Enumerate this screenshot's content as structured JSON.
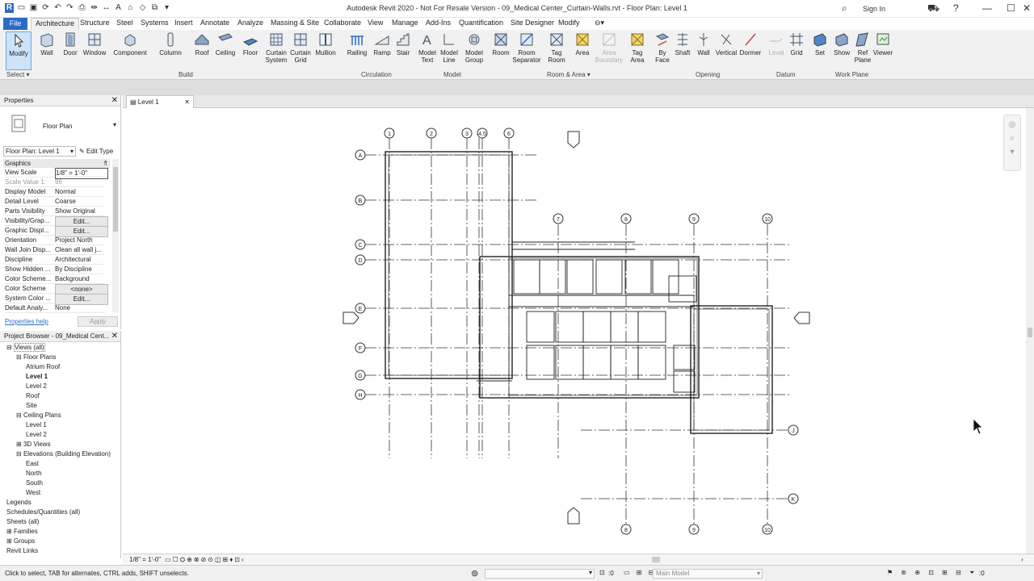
{
  "app": {
    "title": "Autodesk Revit 2020 - Not For Resale Version - 09_Medical Center_Curtain-Walls.rvt - Floor Plan: Level 1",
    "sign_in": "Sign In"
  },
  "tabs": [
    "File",
    "Architecture",
    "Structure",
    "Steel",
    "Systems",
    "Insert",
    "Annotate",
    "Analyze",
    "Massing & Site",
    "Collaborate",
    "View",
    "Manage",
    "Add-Ins",
    "Quantification",
    "Site Designer",
    "Modify"
  ],
  "ribbon": {
    "buttons": [
      {
        "label": "Modify",
        "icon": "modify-cursor-icon"
      },
      {
        "label": "Wall",
        "icon": "wall-icon"
      },
      {
        "label": "Door",
        "icon": "door-icon"
      },
      {
        "label": "Window",
        "icon": "window-icon"
      },
      {
        "label": "Component",
        "icon": "component-icon"
      },
      {
        "label": "Column",
        "icon": "column-icon"
      },
      {
        "label": "Roof",
        "icon": "roof-icon"
      },
      {
        "label": "Ceiling",
        "icon": "ceiling-icon"
      },
      {
        "label": "Floor",
        "icon": "floor-icon"
      },
      {
        "label": "Curtain System",
        "icon": "curtain-system-icon"
      },
      {
        "label": "Curtain Grid",
        "icon": "curtain-grid-icon"
      },
      {
        "label": "Mullion",
        "icon": "mullion-icon"
      },
      {
        "label": "Railing",
        "icon": "railing-icon"
      },
      {
        "label": "Ramp",
        "icon": "ramp-icon"
      },
      {
        "label": "Stair",
        "icon": "stair-icon"
      },
      {
        "label": "Model Text",
        "icon": "model-text-icon"
      },
      {
        "label": "Model Line",
        "icon": "model-line-icon"
      },
      {
        "label": "Model Group",
        "icon": "model-group-icon"
      },
      {
        "label": "Room",
        "icon": "room-icon"
      },
      {
        "label": "Room Separator",
        "icon": "room-separator-icon"
      },
      {
        "label": "Tag Room",
        "icon": "tag-room-icon"
      },
      {
        "label": "Area",
        "icon": "area-icon"
      },
      {
        "label": "Area Boundary",
        "icon": "area-boundary-icon"
      },
      {
        "label": "Tag Area",
        "icon": "tag-area-icon"
      },
      {
        "label": "By Face",
        "icon": "by-face-icon"
      },
      {
        "label": "Shaft",
        "icon": "shaft-icon"
      },
      {
        "label": "Wall",
        "icon": "wall-opening-icon"
      },
      {
        "label": "Vertical",
        "icon": "vertical-opening-icon"
      },
      {
        "label": "Dormer",
        "icon": "dormer-icon"
      },
      {
        "label": "Level",
        "icon": "level-icon"
      },
      {
        "label": "Grid",
        "icon": "grid-icon"
      },
      {
        "label": "Set",
        "icon": "set-icon"
      },
      {
        "label": "Show",
        "icon": "show-icon"
      },
      {
        "label": "Ref Plane",
        "icon": "ref-plane-icon"
      },
      {
        "label": "Viewer",
        "icon": "viewer-icon"
      }
    ],
    "groups": [
      "Select",
      "Build",
      "Circulation",
      "Model",
      "Room & Area",
      "Opening",
      "Datum",
      "Work Plane"
    ]
  },
  "properties": {
    "title": "Properties",
    "type_name": "Floor Plan",
    "instance_selector": "Floor Plan: Level 1",
    "edit_type": "Edit Type",
    "section": "Graphics",
    "rows": [
      {
        "k": "View Scale",
        "v": "1/8\" = 1'-0\""
      },
      {
        "k": "Scale Value  1:",
        "v": "96"
      },
      {
        "k": "Display Model",
        "v": "Normal"
      },
      {
        "k": "Detail Level",
        "v": "Coarse"
      },
      {
        "k": "Parts Visibility",
        "v": "Show Original"
      },
      {
        "k": "Visibility/Grap...",
        "v": "Edit..."
      },
      {
        "k": "Graphic Displ...",
        "v": "Edit..."
      },
      {
        "k": "Orientation",
        "v": "Project North"
      },
      {
        "k": "Wall Join Disp...",
        "v": "Clean all wall j..."
      },
      {
        "k": "Discipline",
        "v": "Architectural"
      },
      {
        "k": "Show Hidden ...",
        "v": "By Discipline"
      },
      {
        "k": "Color Scheme...",
        "v": "Background"
      },
      {
        "k": "Color Scheme",
        "v": "<none>"
      },
      {
        "k": "System Color ...",
        "v": "Edit..."
      },
      {
        "k": "Default Analy...",
        "v": "None"
      }
    ],
    "help": "Properties help",
    "apply": "Apply"
  },
  "browser": {
    "title": "Project Browser - 09_Medical Cent...",
    "nodes": [
      "Views (all)",
      "Floor Plans",
      "Atrium Roof",
      "Level 1",
      "Level 2",
      "Roof",
      "Site",
      "Ceiling Plans",
      "Level 1",
      "Level 2",
      "3D Views",
      "Elevations (Building Elevation)",
      "East",
      "North",
      "South",
      "West",
      "Legends",
      "Schedules/Quantities (all)",
      "Sheets (all)",
      "Families",
      "Groups",
      "Revit Links"
    ]
  },
  "view": {
    "tab": "Level 1",
    "scale": "1/8\" = 1'-0\"",
    "grids_top": [
      "1",
      "2",
      "3",
      "4.5",
      "6"
    ],
    "grids_mid": [
      "7",
      "8",
      "9",
      "10"
    ],
    "grids_bottom": [
      "8",
      "9",
      "10"
    ],
    "grids_left": [
      "A",
      "B",
      "C",
      "D",
      "E",
      "F",
      "G",
      "H"
    ],
    "grids_right": [
      "J",
      "K"
    ]
  },
  "status": {
    "hint": "Click to select, TAB for alternates, CTRL adds, SHIFT unselects.",
    "zero": ":0",
    "model": "Main Model"
  },
  "colors": {
    "accent": "#2a6cc4",
    "ribbon": "#f1f1f1",
    "grid_line": "#333333"
  }
}
